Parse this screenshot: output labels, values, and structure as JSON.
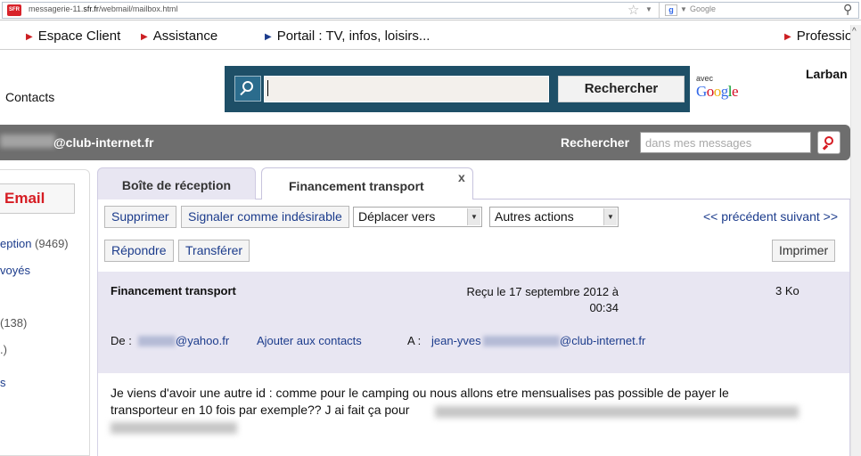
{
  "browser": {
    "favicon_text": "SFR",
    "url_prefix": "messagerie-11.",
    "url_domain": "sfr.fr",
    "url_path": "/webmail/mailbox.html",
    "search_placeholder": "Google"
  },
  "topnav": {
    "items": [
      {
        "label": "Espace Client"
      },
      {
        "label": "Assistance"
      },
      {
        "label": "Portail : TV, infos, loisirs..."
      },
      {
        "label": "Professio"
      }
    ]
  },
  "header": {
    "contacts_link": "Contacts",
    "search_button": "Rechercher",
    "avec_label": "avec",
    "user_name_partial": "Larban"
  },
  "account_bar": {
    "email_domain": "@club-internet.fr",
    "search_label": "Rechercher",
    "search_placeholder": "dans mes messages"
  },
  "sidebar": {
    "email_button": "Email",
    "items": [
      {
        "label": "eption",
        "count": "(9469)"
      },
      {
        "label": "voyés",
        "count": ""
      },
      {
        "label": "",
        "count": "(138)"
      },
      {
        "label": ".)",
        "count": ""
      },
      {
        "label": "s",
        "count": ""
      }
    ]
  },
  "tabs": [
    {
      "label": "Boîte de réception"
    },
    {
      "label": "Financement transport"
    }
  ],
  "tab_close_glyph": "x",
  "toolbar": {
    "delete_label": "Supprimer",
    "spam_label": "Signaler comme indésirable",
    "move_select_value": "Déplacer vers",
    "actions_select_value": "Autres actions",
    "pager_label": "<< précédent suivant >>",
    "reply_label": "Répondre",
    "forward_label": "Transférer",
    "print_label": "Imprimer"
  },
  "message": {
    "subject": "Financement transport",
    "received_line1": "Reçu le 17 septembre 2012 à",
    "received_line2": "00:34",
    "size": "3 Ko",
    "from_label": "De :",
    "from_domain": "@yahoo.fr",
    "add_contact": "Ajouter aux contacts",
    "to_label": "A :",
    "to_first": "jean-yves",
    "to_domain": "@club-internet.fr",
    "body_line1": "Je viens d'avoir une autre id : comme pour le camping ou nous allons etre mensualises pas possible de payer le",
    "body_line2": "transporteur en 10 fois par exemple?? J ai fait ça pour"
  },
  "colors": {
    "brand_red": "#d61c23",
    "search_block": "#1e4f67",
    "account_bar": "#6e6e6e",
    "link_blue": "#1c3c8c",
    "lavender": "#e8e6f2"
  },
  "icons": {
    "bookmark": "star-icon",
    "search": "search-icon",
    "scroll_up": "arrow-up-icon"
  }
}
